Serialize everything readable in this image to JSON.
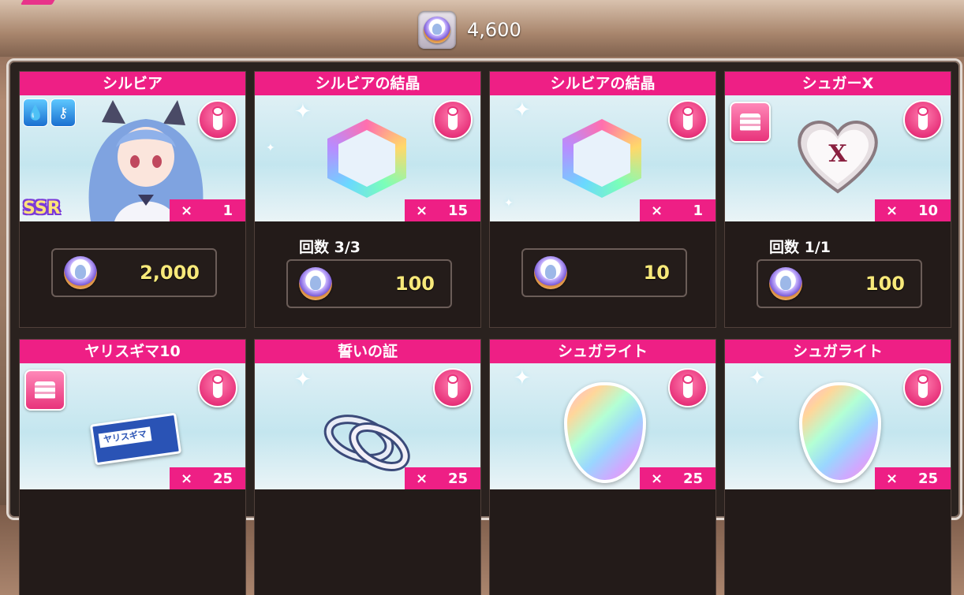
{
  "currency": {
    "icon": "character-coin-icon",
    "amount": "4,600"
  },
  "cards": [
    {
      "title": "シルビア",
      "qty_x": "×",
      "qty": "1",
      "count_label": "",
      "price": "2,000",
      "art": "character-portrait",
      "has_elements": true,
      "rarity": "SSR"
    },
    {
      "title": "シルビアの結晶",
      "qty_x": "×",
      "qty": "15",
      "count_label": "回数  3/3",
      "price": "100",
      "art": "crystal"
    },
    {
      "title": "シルビアの結晶",
      "qty_x": "×",
      "qty": "1",
      "count_label": "",
      "price": "10",
      "art": "crystal"
    },
    {
      "title": "シュガーX",
      "qty_x": "×",
      "qty": "10",
      "count_label": "回数  1/1",
      "price": "100",
      "art": "heart-candy",
      "heart_letter": "X",
      "has_cake": true
    },
    {
      "title": "ヤリスギマ10",
      "qty_x": "×",
      "qty": "25",
      "art": "medicine-box",
      "medicine_label": "ヤリスギマ",
      "has_cake": true
    },
    {
      "title": "誓いの証",
      "qty_x": "×",
      "qty": "25",
      "art": "rings"
    },
    {
      "title": "シュガライト",
      "qty_x": "×",
      "qty": "25",
      "art": "gem"
    },
    {
      "title": "シュガライト",
      "qty_x": "×",
      "qty": "25",
      "art": "gem"
    }
  ],
  "colors": {
    "accent_pink": "#ee1f85",
    "price_yellow": "#f7e97a",
    "panel_bg": "#2a221f"
  }
}
